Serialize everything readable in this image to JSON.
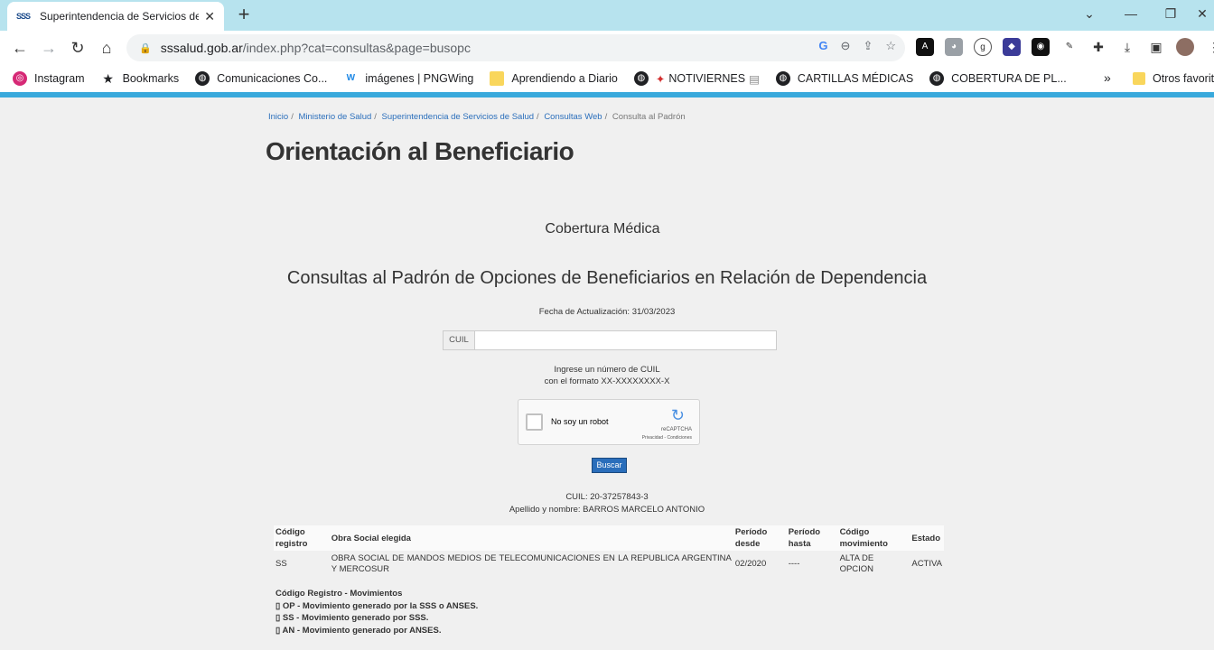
{
  "browser": {
    "tab_icon": "SSS",
    "tab_title": "Superintendencia de Servicios de",
    "url_host": "sssalud.gob.ar",
    "url_path": "/index.php?cat=consultas&page=busopc",
    "bookmarks": [
      {
        "label": "Instagram",
        "icon": "instagram-icon",
        "color": "#d62976"
      },
      {
        "label": "Bookmarks",
        "icon": "star-icon",
        "color": "#202124"
      },
      {
        "label": "Comunicaciones Co...",
        "icon": "globe-icon",
        "color": "#202124"
      },
      {
        "label": "imágenes | PNGWing",
        "icon": "pngwing-icon",
        "color": "#1e88e5"
      },
      {
        "label": "Aprendiendo a Diario",
        "icon": "folder-icon",
        "color": "#f9d65c"
      },
      {
        "label": "NOTIVIERNES",
        "icon": "globe-icon",
        "color": "#202124"
      },
      {
        "label": "CARTILLAS MÉDICAS",
        "icon": "globe-icon",
        "color": "#202124"
      },
      {
        "label": "COBERTURA DE PL...",
        "icon": "globe-icon",
        "color": "#202124"
      }
    ],
    "other_bookmarks": "Otros favoritos"
  },
  "breadcrumb": {
    "items": [
      "Inicio",
      "Ministerio de Salud",
      "Superintendencia de Servicios de Salud",
      "Consultas Web"
    ],
    "current": "Consulta al Padrón"
  },
  "page": {
    "title": "Orientación al Beneficiario",
    "section": "Cobertura Médica",
    "heading": "Consultas al Padrón de Opciones de Beneficiarios en Relación de Dependencia",
    "fecha": "Fecha de Actualización: 31/03/2023"
  },
  "form": {
    "cuil_label": "CUIL",
    "cuil_value": "",
    "hint_line1": "Ingrese un número de CUIL",
    "hint_line2": "con el formato XX-XXXXXXXX-X",
    "captcha_label": "No soy un robot",
    "captcha_brand": "reCAPTCHA",
    "captcha_links": "Privacidad - Condiciones",
    "search_button": "Buscar"
  },
  "result": {
    "cuil": "CUIL: 20-37257843-3",
    "nombre": "Apellido y nombre: BARROS MARCELO ANTONIO"
  },
  "table": {
    "headers": [
      "Código registro",
      "Obra Social elegida",
      "Período desde",
      "Período hasta",
      "Código movimiento",
      "Estado"
    ],
    "rows": [
      [
        "SS",
        "OBRA SOCIAL DE MANDOS MEDIOS DE TELECOMUNICACIONES EN LA REPUBLICA ARGENTINA Y MERCOSUR",
        "02/2020",
        "----",
        "ALTA DE OPCION",
        "ACTIVA"
      ]
    ]
  },
  "legend": {
    "title": "Código Registro - Movimientos",
    "items": [
      "OP - Movimiento generado por la SSS o ANSES.",
      "SS - Movimiento generado por SSS.",
      "AN - Movimiento generado por ANSES."
    ]
  }
}
